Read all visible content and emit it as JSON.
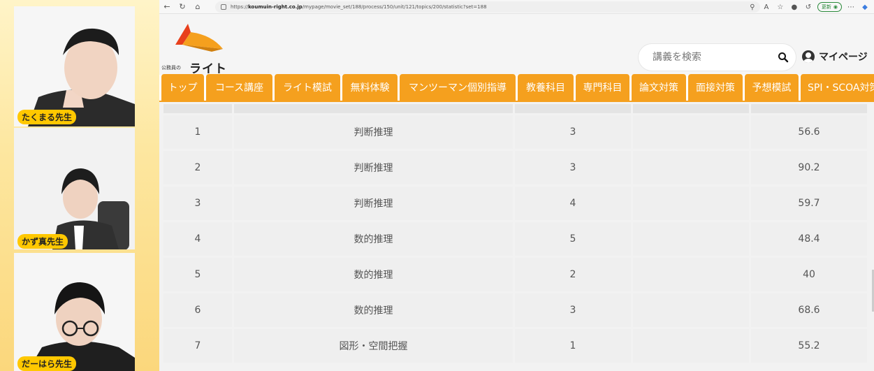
{
  "participants": [
    {
      "name": "たくまる先生"
    },
    {
      "name": "かず真先生"
    },
    {
      "name": "だーはら先生"
    }
  ],
  "browser": {
    "url_prefix": "https://",
    "url_host": "koumuin-right.co.jp",
    "url_path": "/mypage/movie_set/188/process/150/unit/121/topics/200/statistic?set=188",
    "update_label": "更新"
  },
  "site": {
    "logo_sub": "公務員の",
    "logo_main": "ライト",
    "search_placeholder": "講義を検索",
    "mypage_label": "マイページ",
    "accent_color": "#f5a01e"
  },
  "nav": {
    "items": [
      "トップ",
      "コース講座",
      "ライト模試",
      "無料体験",
      "マンツーマン個別指導",
      "教養科目",
      "専門科目",
      "論文対策",
      "面接対策",
      "予想模試",
      "SPI・SCOA対策"
    ]
  },
  "table": {
    "rows": [
      {
        "no": "1",
        "subject": "判断推理",
        "level": "3",
        "value": "56.6"
      },
      {
        "no": "2",
        "subject": "判断推理",
        "level": "3",
        "value": "90.2"
      },
      {
        "no": "3",
        "subject": "判断推理",
        "level": "4",
        "value": "59.7"
      },
      {
        "no": "4",
        "subject": "数的推理",
        "level": "5",
        "value": "48.4"
      },
      {
        "no": "5",
        "subject": "数的推理",
        "level": "2",
        "value": "40"
      },
      {
        "no": "6",
        "subject": "数的推理",
        "level": "3",
        "value": "68.6"
      },
      {
        "no": "7",
        "subject": "図形・空間把握",
        "level": "1",
        "value": "55.2"
      }
    ]
  }
}
